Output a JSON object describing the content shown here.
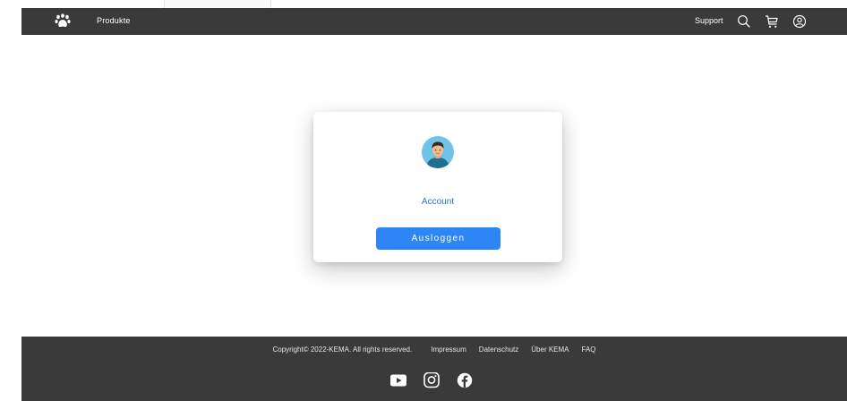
{
  "navbar": {
    "products_label": "Produkte",
    "support_label": "Support",
    "icons": [
      "paw-logo-icon",
      "search-icon",
      "cart-icon",
      "user-icon"
    ]
  },
  "account_card": {
    "account_label": "Account",
    "logout_label": "Ausloggen",
    "accent_color": "#2d86f3"
  },
  "footer": {
    "copyright": "Copyright© 2022-KEMA. All rights reserved.",
    "links": [
      "Impressum",
      "Datenschutz",
      "Über KEMA",
      "FAQ"
    ],
    "social_icons": [
      "youtube-icon",
      "instagram-icon",
      "facebook-icon"
    ]
  }
}
